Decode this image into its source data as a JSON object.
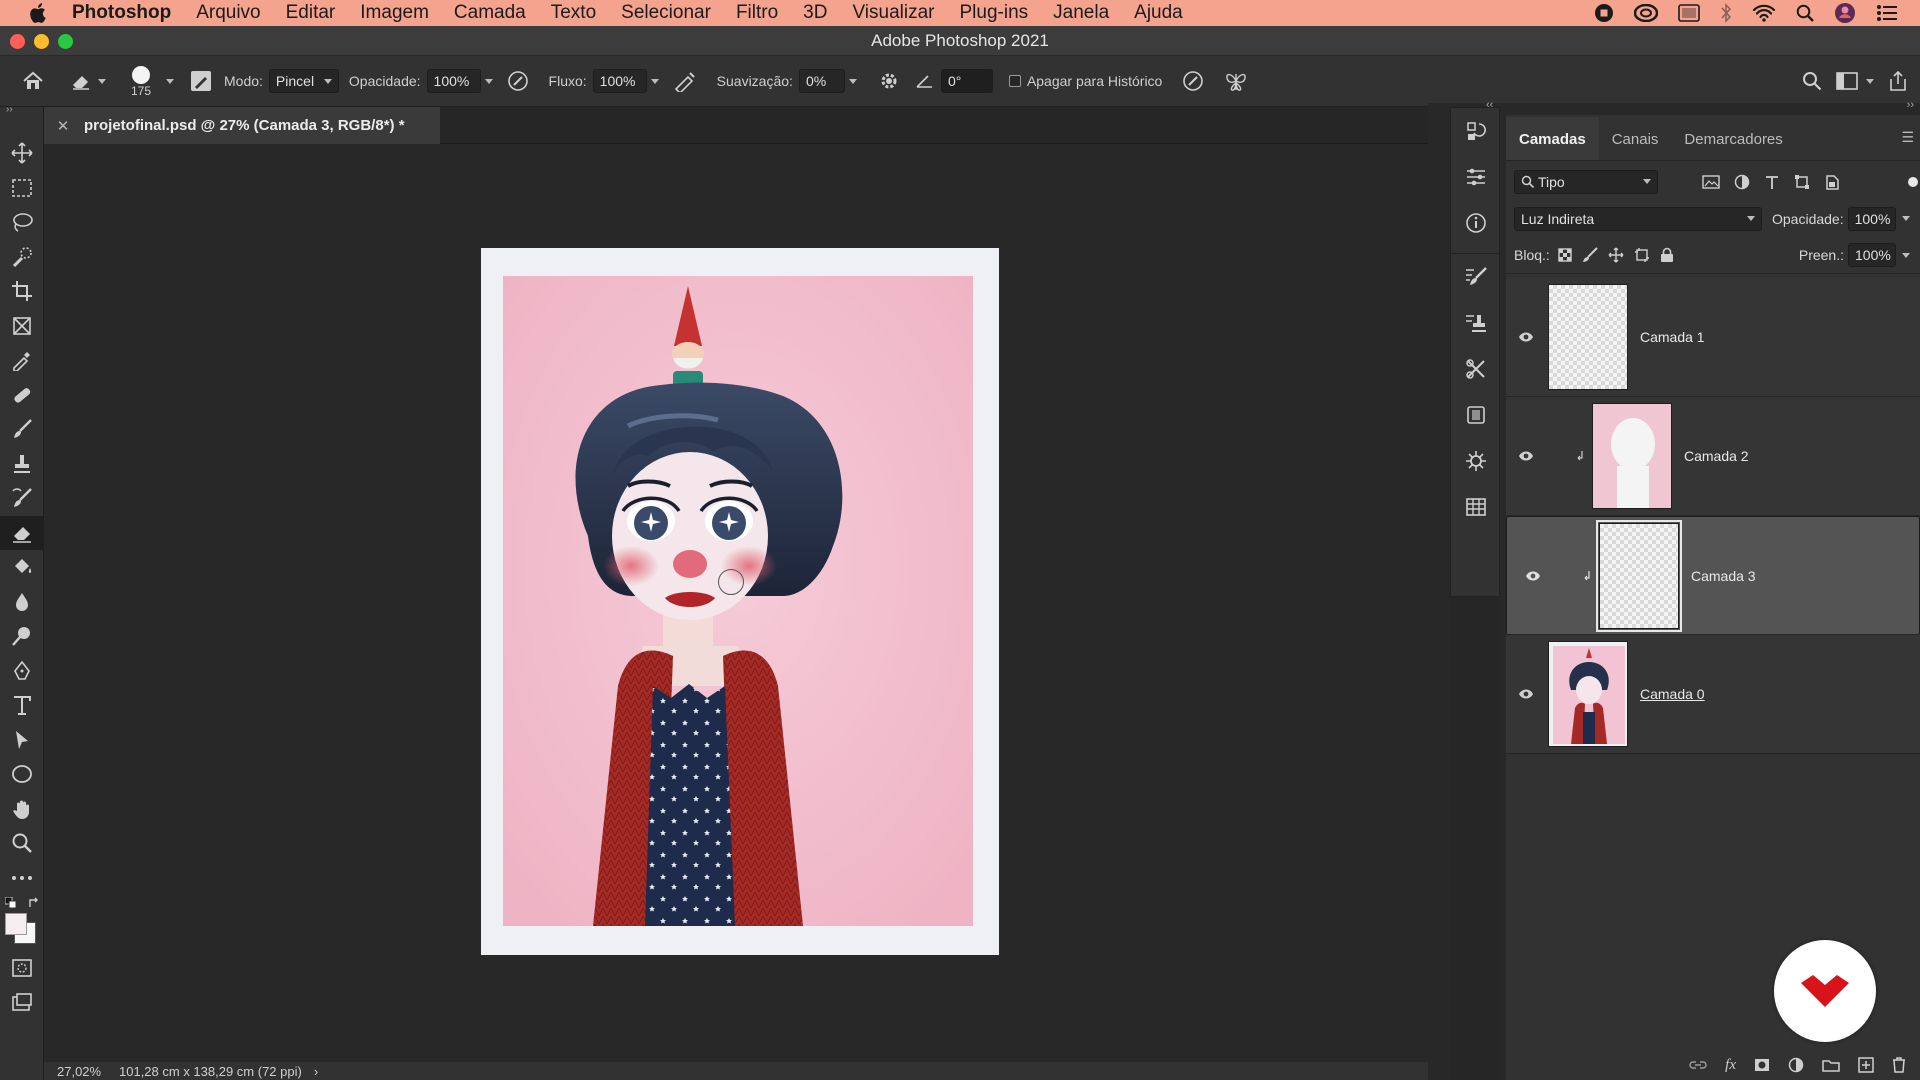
{
  "menubar": {
    "app": "Photoshop",
    "items": [
      "Arquivo",
      "Editar",
      "Imagem",
      "Camada",
      "Texto",
      "Selecionar",
      "Filtro",
      "3D",
      "Visualizar",
      "Plug-ins",
      "Janela",
      "Ajuda"
    ]
  },
  "window": {
    "title": "Adobe Photoshop 2021"
  },
  "options": {
    "brush_size": "175",
    "mode_label": "Modo:",
    "mode_value": "Pincel",
    "opacity_label": "Opacidade:",
    "opacity_value": "100%",
    "flow_label": "Fluxo:",
    "flow_value": "100%",
    "smoothing_label": "Suavização:",
    "smoothing_value": "0%",
    "angle_value": "0°",
    "erase_history_label": "Apagar para Histórico"
  },
  "document": {
    "tab_title": "projetofinal.psd @ 27% (Camada 3, RGB/8*) *",
    "zoom": "27,02%",
    "dimensions": "101,28 cm x 138,29 cm (72 ppi)"
  },
  "layers_panel": {
    "tabs": [
      "Camadas",
      "Canais",
      "Demarcadores"
    ],
    "filter_value": "Tipo",
    "blend_mode": "Luz Indireta",
    "opacity_label": "Opacidade:",
    "opacity_value": "100%",
    "lock_label": "Bloq.:",
    "fill_label": "Preen.:",
    "fill_value": "100%",
    "layers": [
      {
        "name": "Camada 1"
      },
      {
        "name": "Camada 2"
      },
      {
        "name": "Camada 3"
      },
      {
        "name": "Camada 0"
      }
    ]
  },
  "colors": {
    "menubar": "#f4a38e",
    "panel": "#323232",
    "canvas": "#282828",
    "paper_pink": "#f2c3d2",
    "badge_red": "#d9131a"
  }
}
